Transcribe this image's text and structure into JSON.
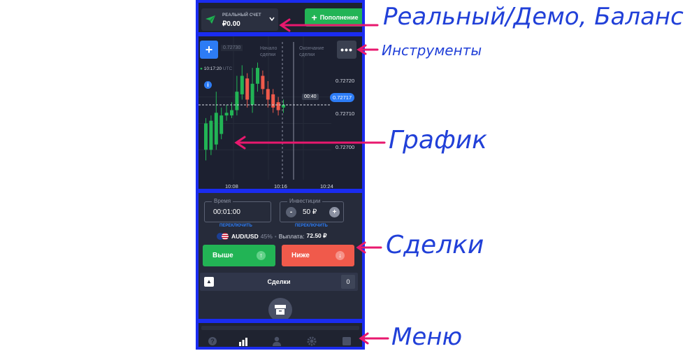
{
  "header": {
    "account_label": "РЕАЛЬНЫЙ СЧЕТ",
    "balance": "₽0.00",
    "deposit_label": "Пополнение"
  },
  "chart": {
    "top_price": "0.72730",
    "label_start": [
      "Начало",
      "сделки"
    ],
    "label_end": [
      "Окончание",
      "сделки"
    ],
    "time": "10:17:20",
    "utc": "UTC",
    "info": "i",
    "y_ticks": [
      "0.72720",
      "0.72710",
      "0.72700"
    ],
    "current_price": "0.72717",
    "timer": "00:40",
    "x_ticks": [
      "10:08",
      "10:16",
      "10:24"
    ],
    "more_label": "•••",
    "add_label": "+"
  },
  "trade": {
    "time_legend": "Время",
    "time_value": "00:01:00",
    "time_switch": "ПЕРЕКЛЮЧИТЬ",
    "invest_legend": "Инвестиции",
    "invest_value": "50 ₽",
    "invest_switch": "ПЕРЕКЛЮЧИТЬ",
    "pair": "AUD/USD",
    "pair_percent": "45%",
    "payout_label": "Выплата:",
    "payout_value": "72.50 ₽",
    "up_label": "Выше",
    "down_label": "Ниже",
    "deals_title": "Сделки",
    "deals_count": "0"
  },
  "annotations": {
    "real_demo_balance": "Реальный/Демо, Баланс",
    "instruments": "Инструменты",
    "chart": "График",
    "deals": "Сделки",
    "menu": "Меню"
  },
  "colors": {
    "annotation_box": "#1a2cf0",
    "arrow": "#e8186e",
    "annotation_text": "#2140d8",
    "green": "#22b455",
    "red": "#f05a4b",
    "accent": "#2d7cf5"
  },
  "chart_data": {
    "type": "candlestick",
    "title": "",
    "xlabel": "",
    "ylabel": "",
    "x_ticks": [
      "10:08",
      "10:16",
      "10:24"
    ],
    "y_ticks": [
      "0.72700",
      "0.72710",
      "0.72720"
    ],
    "current_price": 0.72717,
    "candles": [
      {
        "open": 0.727,
        "close": 0.7271,
        "high": 0.72712,
        "low": 0.72696
      },
      {
        "open": 0.727,
        "close": 0.72711,
        "high": 0.72713,
        "low": 0.72698
      },
      {
        "open": 0.72702,
        "close": 0.72714,
        "high": 0.72722,
        "low": 0.727
      },
      {
        "open": 0.72706,
        "close": 0.72713,
        "high": 0.72716,
        "low": 0.72704
      },
      {
        "open": 0.72713,
        "close": 0.72714,
        "high": 0.72717,
        "low": 0.72711
      },
      {
        "open": 0.72713,
        "close": 0.72715,
        "high": 0.72718,
        "low": 0.72712
      },
      {
        "open": 0.72715,
        "close": 0.72722,
        "high": 0.72728,
        "low": 0.72713
      },
      {
        "open": 0.72721,
        "close": 0.72728,
        "high": 0.72732,
        "low": 0.72719
      },
      {
        "open": 0.72727,
        "close": 0.72719,
        "high": 0.72729,
        "low": 0.72716
      },
      {
        "open": 0.72717,
        "close": 0.72725,
        "high": 0.72731,
        "low": 0.72714
      },
      {
        "open": 0.72725,
        "close": 0.72731,
        "high": 0.72733,
        "low": 0.72722
      },
      {
        "open": 0.72728,
        "close": 0.72723,
        "high": 0.7273,
        "low": 0.72721
      },
      {
        "open": 0.72723,
        "close": 0.72719,
        "high": 0.72726,
        "low": 0.72716
      },
      {
        "open": 0.72721,
        "close": 0.72716,
        "high": 0.72723,
        "low": 0.72714
      },
      {
        "open": 0.72718,
        "close": 0.72715,
        "high": 0.7272,
        "low": 0.72713
      },
      {
        "open": 0.72716,
        "close": 0.72717,
        "high": 0.72719,
        "low": 0.72714
      }
    ]
  }
}
